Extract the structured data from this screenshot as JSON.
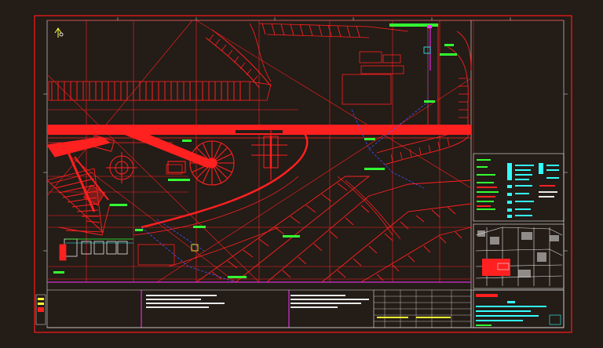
{
  "app": {
    "background": "#231c17",
    "sheet_border_color": "#ff1a1a",
    "accent_colors": {
      "red": "#ff2020",
      "green": "#33ff33",
      "cyan": "#33ffff",
      "magenta": "#ff33ff",
      "blue": "#3344ff",
      "white": "#e8e8e8",
      "yellow": "#ffff33"
    }
  },
  "drawing": {
    "north_arrow_icon": "north-arrow-icon",
    "legend_title_icon": "legend-block-icon",
    "keyplan_icon": "key-plan-icon"
  }
}
